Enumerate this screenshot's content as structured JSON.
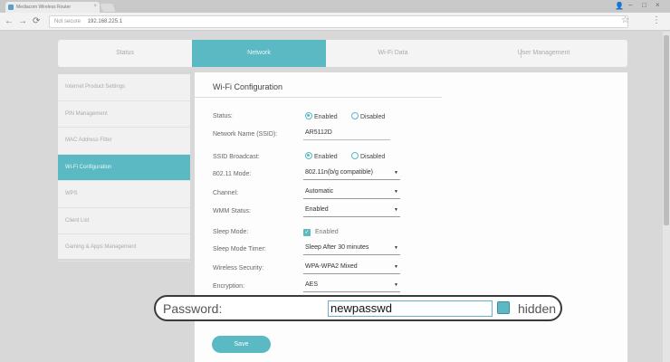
{
  "browser": {
    "tab_title": "Mediacom Wireless Router",
    "tab_close": "×",
    "omnibox_secure": "Not secure",
    "omnibox_url": "192.168.225.1",
    "back": "←",
    "forward": "→",
    "reload": "⟳",
    "star": "☆",
    "menu": "⋮",
    "user": "👤",
    "min": "–",
    "max": "□",
    "close": "×"
  },
  "topnav": {
    "items": [
      "Status",
      "Network",
      "Wi-Fi Data",
      "User Management"
    ],
    "active": "Network"
  },
  "sidebar": {
    "items": [
      "Internet Product Settings",
      "PIN Management",
      "MAC Address Filter",
      "Wi-Fi Configuration",
      "WPS",
      "Client List",
      "Gaming & Apps Management"
    ],
    "active_index": 3
  },
  "panel": {
    "title": "Wi-Fi Configuration",
    "status_label": "Status:",
    "status_enabled": "Enabled",
    "status_disabled": "Disabled",
    "ssid_label": "Network Name (SSID):",
    "ssid_value": "AR5112D",
    "broadcast_label": "SSID Broadcast:",
    "broadcast_enabled": "Enabled",
    "broadcast_disabled": "Disabled",
    "mode_label": "802.11 Mode:",
    "mode_value": "802.11n(b/g compatible)",
    "channel_label": "Channel:",
    "channel_value": "Automatic",
    "wmm_label": "WMM Status:",
    "wmm_value": "Enabled",
    "sleep_label": "Sleep Mode:",
    "sleep_value": "Enabled",
    "sleep_timer_label": "Sleep Mode Timer:",
    "sleep_timer_value": "Sleep After 30 minutes",
    "security_label": "Wireless Security:",
    "security_value": "WPA-WPA2 Mixed",
    "encryption_label": "Encryption:",
    "encryption_value": "AES",
    "save_label": "Save",
    "arrow": "▼",
    "check": "✓"
  },
  "password": {
    "label": "Password:",
    "value": "newpasswd",
    "hidden_label": "hidden"
  },
  "colors": {
    "accent": "#5bb9c3"
  }
}
